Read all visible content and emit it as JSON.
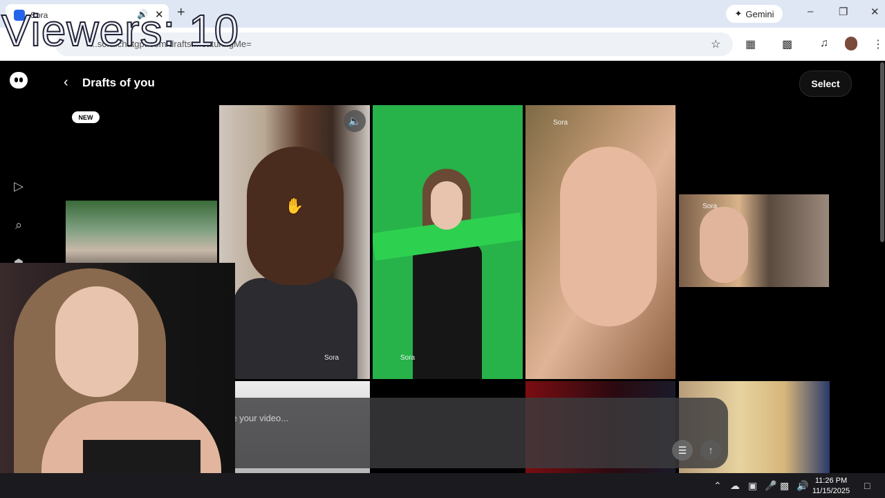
{
  "overlay": {
    "viewers_text": "Viewers: 10"
  },
  "browser": {
    "tab_title": "Sora",
    "new_tab_symbol": "+",
    "gemini_label": "Gemini",
    "url_text": "...sora.chatgpt.com/drafts...featuringMe=",
    "window_controls": {
      "minimize": "–",
      "restore": "❐",
      "close": "✕"
    }
  },
  "page": {
    "title": "Drafts of you",
    "back_symbol": "‹",
    "select_label": "Select",
    "new_badge": "NEW",
    "prompt_placeholder": "scribe your video...",
    "watermarks": [
      "Sora",
      "Sora",
      "Sora",
      "Sora"
    ]
  },
  "sidebar": {
    "items": [
      {
        "icon": "play-circle-icon",
        "glyph": "▷"
      },
      {
        "icon": "search-icon",
        "glyph": "⌕"
      },
      {
        "icon": "trophy-icon",
        "glyph": "☗"
      },
      {
        "icon": "bell-icon",
        "glyph": "⍾"
      }
    ]
  },
  "taskbar": {
    "time": "11:26 PM",
    "date": "11/15/2025"
  },
  "colors": {
    "accent_green": "#27b24a",
    "tab_bar": "#dfe7f4",
    "page_bg": "#000000"
  }
}
